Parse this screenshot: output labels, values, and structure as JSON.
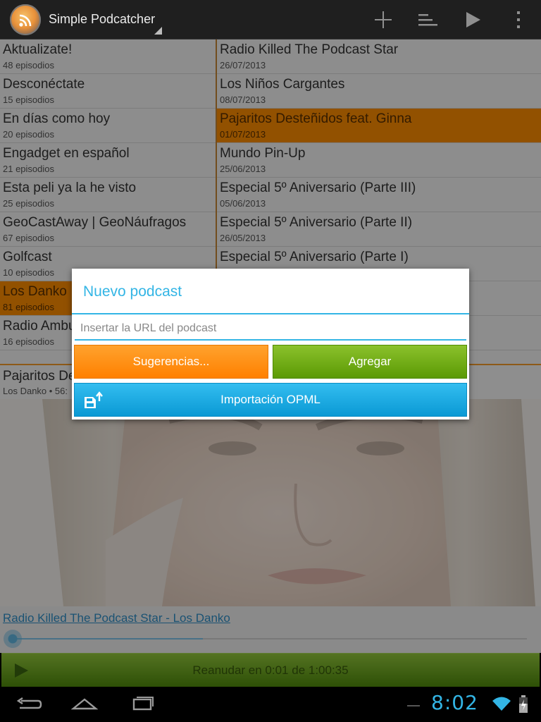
{
  "app": {
    "title": "Simple Podcatcher"
  },
  "icons": {
    "logo": "rss-logo-icon",
    "add": "plus-icon",
    "playlist": "playlist-icon",
    "play": "play-icon",
    "overflow": "overflow-menu-icon"
  },
  "podcasts": [
    {
      "title": "Aktualizate!",
      "subtitle": "48 episodios"
    },
    {
      "title": "Desconéctate",
      "subtitle": "15 episodios"
    },
    {
      "title": "En días como hoy",
      "subtitle": "20 episodios"
    },
    {
      "title": "Engadget en español",
      "subtitle": "21 episodios"
    },
    {
      "title": "Esta peli ya la he visto",
      "subtitle": "25 episodios"
    },
    {
      "title": "GeoCastAway | GeoNáufragos",
      "subtitle": "67 episodios"
    },
    {
      "title": "Golfcast",
      "subtitle": "10 episodios"
    },
    {
      "title": "Los Danko",
      "subtitle": "81 episodios",
      "selected": true
    },
    {
      "title": "Radio Ambulante",
      "subtitle": "16 episodios"
    }
  ],
  "episodes": [
    {
      "title": "Radio Killed The Podcast Star",
      "date": "26/07/2013"
    },
    {
      "title": "Los Niños Cargantes",
      "date": "08/07/2013"
    },
    {
      "title": "Pajaritos Desteñidos feat. Ginna",
      "date": "01/07/2013",
      "selected": true
    },
    {
      "title": "Mundo Pin-Up",
      "date": "25/06/2013"
    },
    {
      "title": "Especial 5º Aniversario (Parte III)",
      "date": "05/06/2013"
    },
    {
      "title": "Especial 5º Aniversario (Parte II)",
      "date": "26/05/2013"
    },
    {
      "title": "Especial 5º Aniversario (Parte I)",
      "date": ""
    },
    {
      "title": "",
      "date": ""
    },
    {
      "title": "",
      "date": ""
    }
  ],
  "now_playing": {
    "title": "Pajaritos Desteñidos feat. Ginna",
    "subtitle": "Los Danko • 56:",
    "link": "Radio Killed The Podcast Star - Los Danko",
    "progress": 0.37,
    "resume": "Reanudar en 0:01 de 1:00:35"
  },
  "dialog": {
    "title": "Nuevo podcast",
    "url_placeholder": "Insertar la URL del podcast",
    "suggestions": "Sugerencias...",
    "add": "Agregar",
    "opml": "Importación OPML"
  },
  "status": {
    "clock": "8:02"
  },
  "colors": {
    "accent": "#33b5e5",
    "selected": "#fb8c00",
    "resume": "#5b9a04"
  }
}
